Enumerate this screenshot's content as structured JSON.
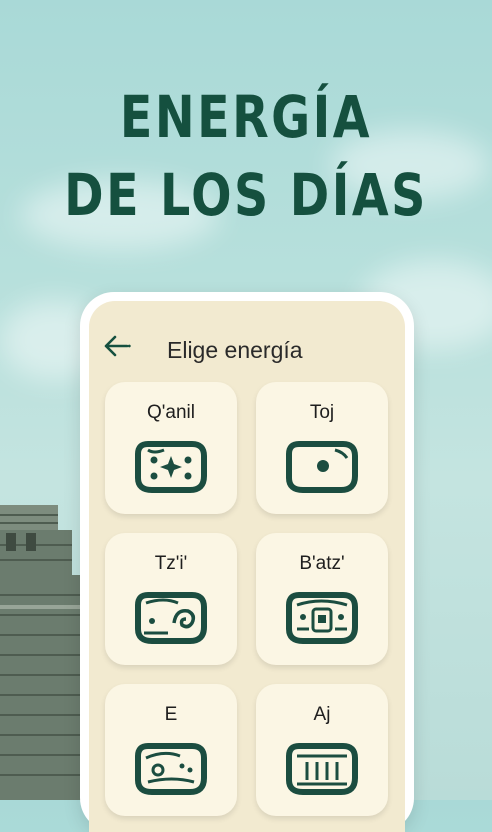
{
  "headline": {
    "line1": "ENERGÍA",
    "line2": "DE LOS DÍAS"
  },
  "screen": {
    "title": "Elige energía",
    "back_icon": "arrow-left-icon"
  },
  "energies": [
    {
      "name": "Q'anil",
      "glyph": "qanil-glyph-icon"
    },
    {
      "name": "Toj",
      "glyph": "toj-glyph-icon"
    },
    {
      "name": "Tz'i'",
      "glyph": "tzi-glyph-icon"
    },
    {
      "name": "B'atz'",
      "glyph": "batz-glyph-icon"
    },
    {
      "name": "E",
      "glyph": "e-glyph-icon"
    },
    {
      "name": "Aj",
      "glyph": "aj-glyph-icon"
    }
  ],
  "colors": {
    "accent": "#15503f",
    "sky": "#b7e0dc",
    "screen": "#f2ead0",
    "card": "#fbf6e4"
  }
}
